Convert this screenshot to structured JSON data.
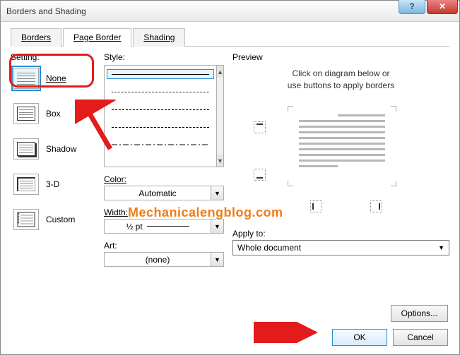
{
  "title": "Borders and Shading",
  "tabs": {
    "borders": "Borders",
    "page_border": "Page Border",
    "shading": "Shading"
  },
  "setting": {
    "label": "Setting:",
    "items": [
      "None",
      "Box",
      "Shadow",
      "3-D",
      "Custom"
    ]
  },
  "style": {
    "label": "Style:",
    "color_label": "Color:",
    "color_value": "Automatic",
    "width_label": "Width:",
    "width_value": "½ pt",
    "art_label": "Art:",
    "art_value": "(none)"
  },
  "preview": {
    "label": "Preview",
    "hint1": "Click on diagram below or",
    "hint2": "use buttons to apply borders",
    "apply_label": "Apply to:",
    "apply_value": "Whole document",
    "options": "Options..."
  },
  "buttons": {
    "ok": "OK",
    "cancel": "Cancel"
  },
  "watermark": "Mechanicalengblog.com"
}
